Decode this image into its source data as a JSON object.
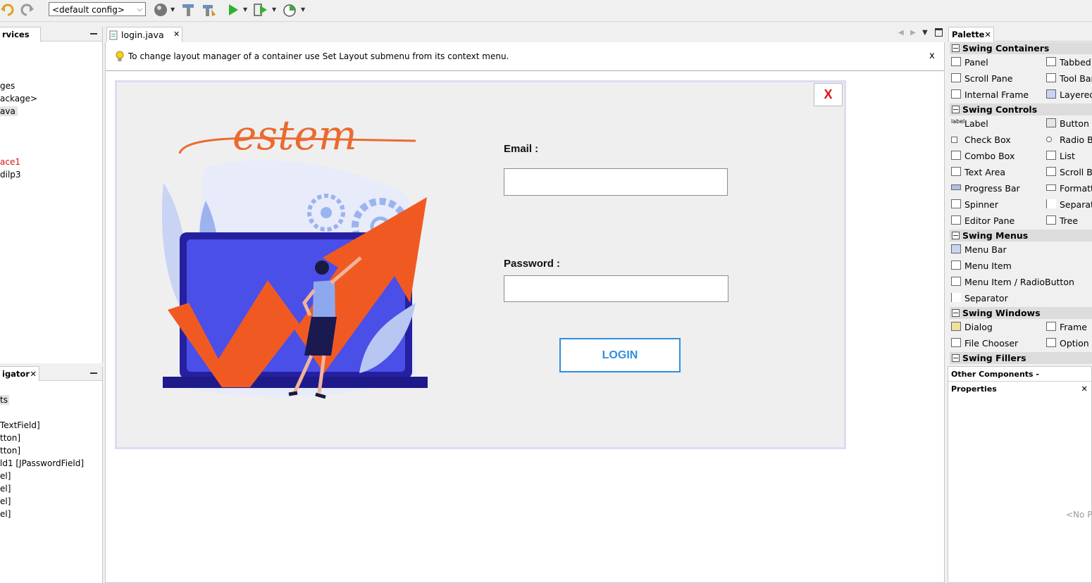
{
  "toolbar": {
    "config_value": "<default config>",
    "icons": [
      "undo-icon",
      "redo-icon",
      "globe-icon",
      "build-icon",
      "clean-build-icon",
      "run-icon",
      "debug-icon",
      "profile-icon"
    ]
  },
  "left_top_panel": {
    "tab_label": "rvices",
    "tree": [
      "ges",
      "ackage>",
      "ava",
      "ace1",
      "dilp3"
    ]
  },
  "left_bottom_panel": {
    "tab_label": "igator",
    "tree": [
      "ts",
      "TextField]",
      "tton]",
      "tton]",
      "ld1 [JPasswordField]",
      "el]",
      "el]",
      "el]",
      "el]"
    ]
  },
  "editor": {
    "file_tab": "login.java",
    "hint": "To change layout manager of a container use Set Layout submenu from its context menu.",
    "hint_close": "x"
  },
  "form": {
    "logo_text": "estem",
    "email_label": "Email :",
    "password_label": "Password :",
    "login_label": "LOGIN",
    "close_label": "X",
    "colors": {
      "accent": "#2e8fe0",
      "close": "#e01010",
      "orange": "#f05a22",
      "navy": "#1f1a8a"
    }
  },
  "palette": {
    "tab_label": "Palette",
    "categories": {
      "containers": "Swing Containers",
      "controls": "Swing Controls",
      "menus": "Swing Menus",
      "windows": "Swing Windows",
      "fillers": "Swing Fillers"
    },
    "items": {
      "panel": "Panel",
      "tabbed": "Tabbed",
      "scroll_pane": "Scroll Pane",
      "tool_bar": "Tool Bar",
      "internal_frame": "Internal Frame",
      "layered": "Layered",
      "label": "Label",
      "button": "Button",
      "check_box": "Check Box",
      "radio": "Radio Bu",
      "combo_box": "Combo Box",
      "list": "List",
      "text_area": "Text Area",
      "scroll_bar": "Scroll Ba",
      "progress_bar": "Progress Bar",
      "formatted": "Formatt",
      "spinner": "Spinner",
      "separator_c": "Separat",
      "editor_pane": "Editor Pane",
      "tree": "Tree",
      "menu_bar": "Menu Bar",
      "menu_item": "Menu Item",
      "menu_item_radio": "Menu Item / RadioButton",
      "separator_m": "Separator",
      "dialog": "Dialog",
      "frame": "Frame",
      "file_chooser": "File Chooser",
      "option": "Option F"
    }
  },
  "properties": {
    "tab_label": "Other Components - Properties",
    "empty_text": "<No Pr"
  }
}
